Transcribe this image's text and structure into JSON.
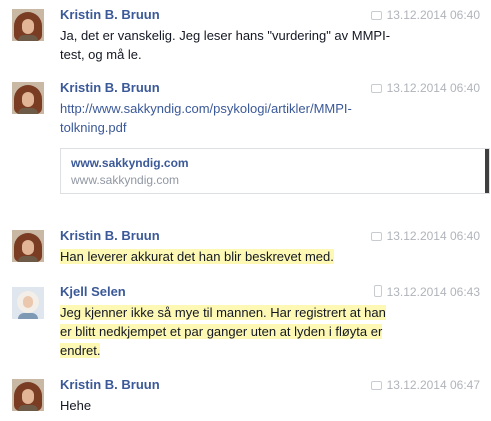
{
  "messages": [
    {
      "sender": "Kristin B. Bruun",
      "time": "13.12.2014 06:40",
      "source": "chat-icon",
      "lines": [
        "Ja, det er vanskelig. Jeg leser hans \"vurdering\" av MMPI-",
        "test, og må le."
      ]
    },
    {
      "sender": "Kristin B. Bruun",
      "time": "13.12.2014 06:40",
      "source": "chat-icon",
      "lines": [
        "http://www.sakkyndig.com/psykologi/artikler/MMPI-",
        "tolkning.pdf"
      ],
      "preview": {
        "title": "www.sakkyndig.com",
        "domain": "www.sakkyndig.com"
      }
    },
    {
      "sender": "Kristin B. Bruun",
      "time": "13.12.2014 06:40",
      "source": "chat-icon",
      "lines": [
        "Han leverer akkurat det han blir beskrevet med."
      ]
    },
    {
      "sender": "Kjell Selen",
      "time": "13.12.2014 06:43",
      "source": "phone-icon",
      "lines": [
        "Jeg kjenner ikke så mye til mannen.  Har registrert at han",
        "er blitt nedkjempet et par ganger uten at lyden i fløyta er",
        "endret."
      ]
    },
    {
      "sender": "Kristin B. Bruun",
      "time": "13.12.2014 06:47",
      "source": "chat-icon",
      "lines": [
        "Hehe"
      ]
    }
  ],
  "colors": {
    "name": "#3b5998",
    "timestamp": "#b0b4ba",
    "highlight": "#fdf8b4",
    "text": "#141823"
  }
}
